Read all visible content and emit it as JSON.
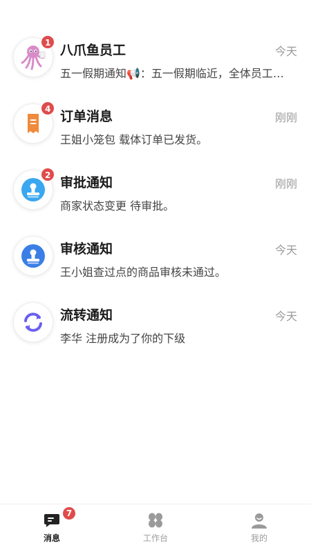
{
  "messages": [
    {
      "title": "八爪鱼员工",
      "time": "今天",
      "preview": "五一假期通知📢：五一假期临近，全体员工…",
      "badge": "1",
      "icon": "octopus-icon"
    },
    {
      "title": "订单消息",
      "time": "刚刚",
      "preview": "王姐小笼包 载体订单已发货。",
      "badge": "4",
      "icon": "order-receipt-icon"
    },
    {
      "title": "审批通知",
      "time": "刚刚",
      "preview": "商家状态变更 待审批。",
      "badge": "2",
      "icon": "approval-stamp-icon"
    },
    {
      "title": "审核通知",
      "time": "今天",
      "preview": "王小姐查过点的商品审核未通过。",
      "icon": "review-stamp-icon"
    },
    {
      "title": "流转通知",
      "time": "今天",
      "preview": "李华 注册成为了你的下级",
      "icon": "transfer-cycle-icon"
    }
  ],
  "tabbar": {
    "messages": {
      "label": "消息",
      "badge": "7",
      "icon": "chat-bubble-icon"
    },
    "workbench": {
      "label": "工作台",
      "icon": "four-leaf-grid-icon"
    },
    "mine": {
      "label": "我的",
      "icon": "user-profile-icon"
    }
  },
  "colors": {
    "badge": "#e04b4b",
    "order_orange": "#f08a3c",
    "approval_blue": "#3aa7f0",
    "review_blue": "#3b7fe6",
    "transfer_purple": "#6a5ff0"
  }
}
